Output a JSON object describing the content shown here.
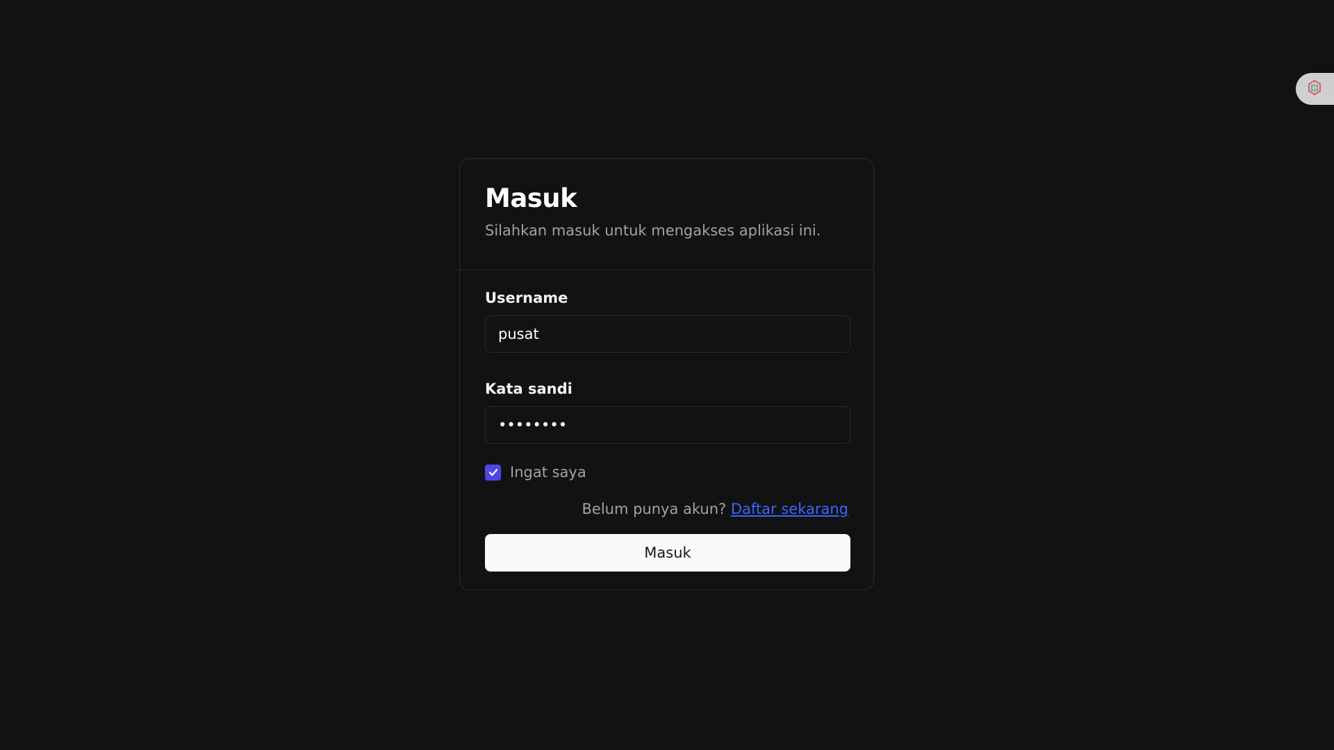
{
  "login": {
    "title": "Masuk",
    "subtitle": "Silahkan masuk untuk mengakses aplikasi ini.",
    "username_label": "Username",
    "username_value": "pusat",
    "password_label": "Kata sandi",
    "password_value": "password",
    "remember_label": "Ingat saya",
    "remember_checked": true,
    "register_prompt": "Belum punya akun?",
    "register_link": "Daftar sekarang",
    "submit_label": "Masuk"
  },
  "colors": {
    "background": "#121212",
    "checkbox_accent": "#4f46e5",
    "link": "#3b66ff",
    "button_bg": "#fafafa"
  },
  "icons": {
    "checkbox_check": "check-icon",
    "extension": "extension-logo-icon"
  }
}
